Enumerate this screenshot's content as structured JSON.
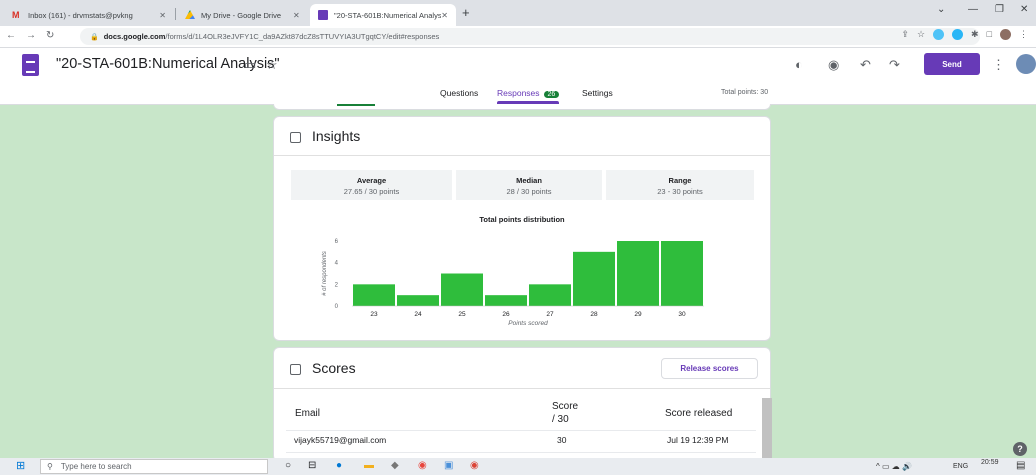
{
  "browser": {
    "tabs": [
      {
        "label": "Inbox (161) - drvmstats@pvkng",
        "icon": "gmail-icon",
        "active": false
      },
      {
        "label": "My Drive - Google Drive",
        "icon": "drive-icon",
        "active": false
      },
      {
        "label": "\"20-STA-601B:Numerical Analysis",
        "icon": "forms-icon",
        "active": true
      }
    ],
    "url_host": "docs.google.com",
    "url_path": "/forms/d/1L4OLR3eJVFY1C_da9AZkt87dcZ8sTTUVYIA3UTgqtCY/edit#responses"
  },
  "header": {
    "title": "\"20-STA-601B:Numerical Analysis\"",
    "send_label": "Send"
  },
  "form_tabs": {
    "questions": "Questions",
    "responses": "Responses",
    "responses_count": "26",
    "settings": "Settings",
    "total_points": "Total points: 30"
  },
  "insights": {
    "title": "Insights",
    "stats": [
      {
        "label": "Average",
        "value": "27.65 / 30 points"
      },
      {
        "label": "Median",
        "value": "28 / 30 points"
      },
      {
        "label": "Range",
        "value": "23 - 30 points"
      }
    ]
  },
  "chart_data": {
    "type": "bar",
    "title": "Total points distribution",
    "xlabel": "Points scored",
    "ylabel": "# of respondents",
    "categories": [
      "23",
      "24",
      "25",
      "26",
      "27",
      "28",
      "29",
      "30"
    ],
    "values": [
      2,
      1,
      3,
      1,
      2,
      5,
      6,
      6
    ],
    "ylim": [
      0,
      6
    ],
    "yticks": [
      0,
      2,
      4,
      6
    ],
    "color": "#2fbd3c"
  },
  "scores": {
    "title": "Scores",
    "release_label": "Release scores",
    "columns": {
      "email": "Email",
      "score": "Score",
      "score_of": "/ 30",
      "released": "Score released"
    },
    "rows": [
      {
        "email": "vijayk55719@gmail.com",
        "score": "30",
        "released": "Jul 19 12:39 PM"
      }
    ]
  },
  "taskbar": {
    "search_placeholder": "Type here to search",
    "lang": "ENG",
    "time": "20:59"
  },
  "colors": {
    "accent": "#673ab7",
    "background": "#c8e6c9",
    "bar": "#2fbd3c"
  }
}
